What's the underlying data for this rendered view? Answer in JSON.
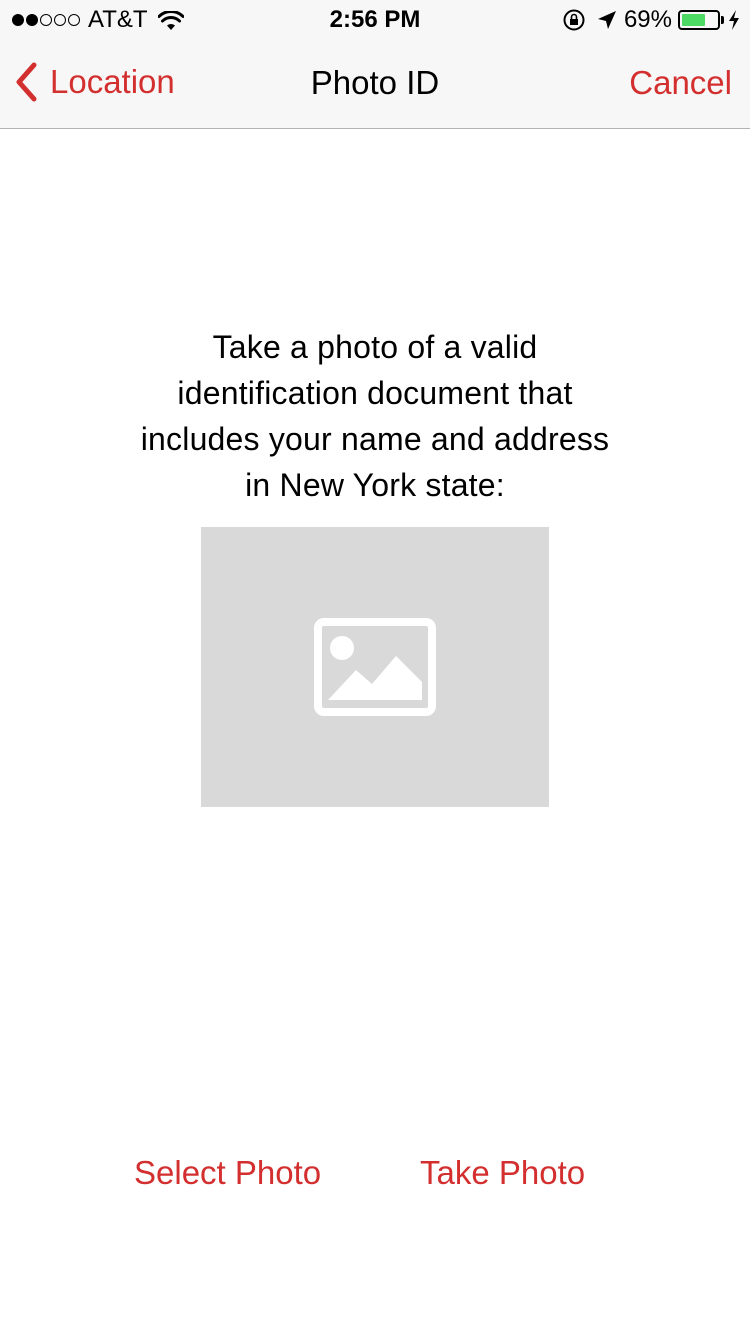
{
  "status_bar": {
    "signal_dots_filled": 2,
    "signal_dots_total": 5,
    "carrier": "AT&T",
    "time": "2:56 PM",
    "battery_percent": "69%",
    "battery_level": 0.69,
    "icons": [
      "wifi-icon",
      "rotation-lock-icon",
      "location-arrow-icon",
      "battery-icon",
      "charging-bolt-icon"
    ]
  },
  "nav": {
    "back_label": "Location",
    "title": "Photo ID",
    "cancel_label": "Cancel"
  },
  "content": {
    "instruction": "Take a photo of a valid identification document that includes your name and address in New York state:",
    "placeholder_icon": "image-placeholder-icon"
  },
  "actions": {
    "select_label": "Select Photo",
    "take_label": "Take Photo"
  },
  "colors": {
    "accent": "#d32f2f",
    "placeholder_bg": "#d9d9d9",
    "battery": "#4cd964"
  }
}
